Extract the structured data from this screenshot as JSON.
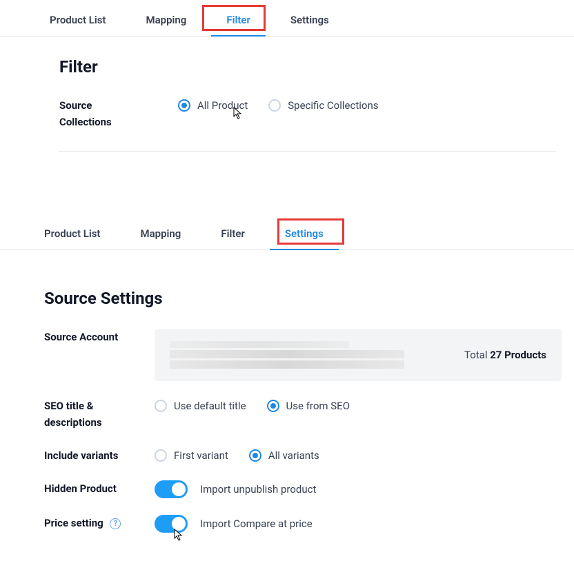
{
  "panel1": {
    "tabs": [
      "Product List",
      "Mapping",
      "Filter",
      "Settings"
    ],
    "active_tab": "Filter",
    "heading": "Filter",
    "source_label_line1": "Source",
    "source_label_line2": "Collections",
    "options": {
      "all_product": "All Product",
      "specific_collections": "Specific Collections"
    }
  },
  "panel2": {
    "tabs": [
      "Product List",
      "Mapping",
      "Filter",
      "Settings"
    ],
    "active_tab": "Settings",
    "heading": "Source Settings",
    "source_account_label": "Source Account",
    "total_prefix": "Total ",
    "total_value": "27 Products",
    "seo_label_line1": "SEO title &",
    "seo_label_line2": "descriptions",
    "seo_options": {
      "default_title": "Use default title",
      "from_seo": "Use from SEO"
    },
    "variants_label": "Include variants",
    "variants_options": {
      "first": "First variant",
      "all": "All variants"
    },
    "hidden_label": "Hidden Product",
    "hidden_toggle_text": "Import unpublish product",
    "price_label": "Price setting",
    "price_toggle_text": "Import Compare at price"
  }
}
